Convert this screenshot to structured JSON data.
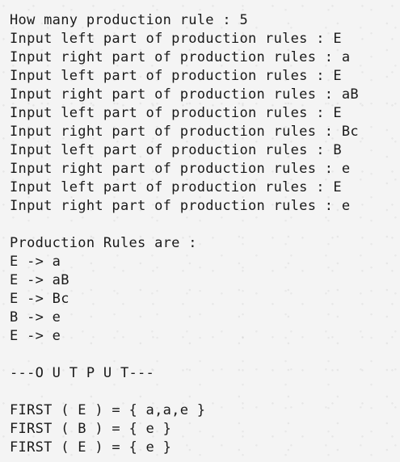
{
  "terminal": {
    "input_lines": [
      "How many production rule : 5",
      "Input left part of production rules : E",
      "Input right part of production rules : a",
      "Input left part of production rules : E",
      "Input right part of production rules : aB",
      "Input left part of production rules : E",
      "Input right part of production rules : Bc",
      "Input left part of production rules : B",
      "Input right part of production rules : e",
      "Input left part of production rules : E",
      "Input right part of production rules : e"
    ],
    "rules_header": "Production Rules are :",
    "rules": [
      "E -> a",
      "E -> aB",
      "E -> Bc",
      "B -> e",
      "E -> e"
    ],
    "output_header": "---O U T P U T---",
    "first_sets": [
      "FIRST ( E ) = { a,a,e }",
      "FIRST ( B ) = { e }",
      "FIRST ( E ) = { e }"
    ]
  }
}
